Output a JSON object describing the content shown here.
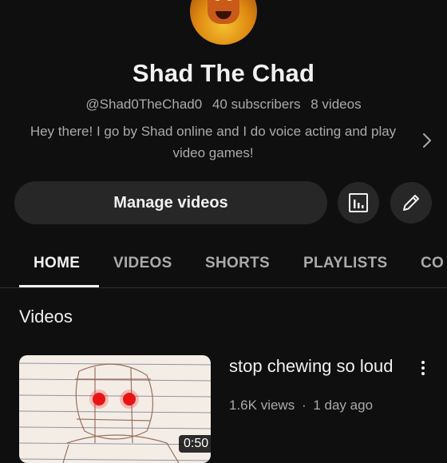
{
  "channel": {
    "name": "Shad The Chad",
    "handle": "@Shad0TheChad0",
    "subscribers": "40 subscribers",
    "videos_count": "8 videos",
    "description": "Hey there! I go by Shad online and I do voice acting and play video games!"
  },
  "actions": {
    "manage_label": "Manage videos",
    "analytics_icon": "analytics-icon",
    "edit_icon": "pencil-icon"
  },
  "tabs": [
    {
      "label": "HOME",
      "active": true
    },
    {
      "label": "VIDEOS",
      "active": false
    },
    {
      "label": "SHORTS",
      "active": false
    },
    {
      "label": "PLAYLISTS",
      "active": false
    },
    {
      "label": "CO",
      "active": false
    }
  ],
  "section": {
    "title": "Videos"
  },
  "video": {
    "title": "stop chewing so loud",
    "views": "1.6K views",
    "separator": "·",
    "age": "1 day ago",
    "duration": "0:50"
  },
  "colors": {
    "background": "#0f0f0f",
    "surface": "#272727",
    "text_primary": "#f1f1f1",
    "text_secondary": "#aaaaaa"
  }
}
